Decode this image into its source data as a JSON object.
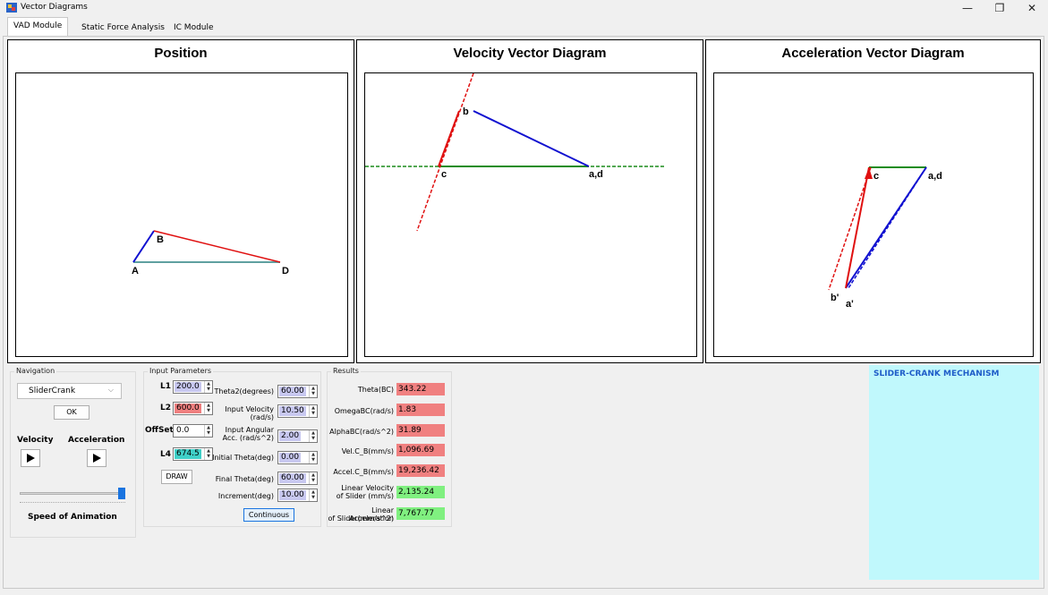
{
  "window": {
    "title": "Vector Diagrams",
    "minimize": "—",
    "restore": "❐",
    "close": "✕"
  },
  "tabs": [
    {
      "label": "VAD Module",
      "active": true
    },
    {
      "label": "Static Force Analysis",
      "active": false
    },
    {
      "label": "IC Module",
      "active": false
    }
  ],
  "panels": {
    "position": {
      "title": "Position",
      "point_labels": {
        "a": "A",
        "b": "B",
        "d": "D"
      }
    },
    "velocity": {
      "title": "Velocity Vector Diagram",
      "point_labels": {
        "b": "b",
        "c": "c",
        "ad": "a,d"
      }
    },
    "acceleration": {
      "title": "Acceleration Vector Diagram",
      "point_labels": {
        "c": "c",
        "ad": "a,d",
        "bp": "b'",
        "ap": "a'"
      }
    }
  },
  "navigation": {
    "legend": "Navigation",
    "mechanism_select": "SliderCrank",
    "ok_label": "OK",
    "velocity_label": "Velocity",
    "acceleration_label": "Acceleration",
    "speed_label": "Speed of Animation",
    "speed_value": 1.0
  },
  "inputs": {
    "legend": "Input Parameters",
    "l1": {
      "label": "L1",
      "value": "200.0"
    },
    "l2": {
      "label": "L2",
      "value": "600.0"
    },
    "offset": {
      "label": "OffSet",
      "value": "0.0"
    },
    "l4": {
      "label": "L4",
      "value": "674.5"
    },
    "theta2": {
      "label": "Theta2(degrees)",
      "value": "60.00"
    },
    "input_velocity": {
      "label_1": "Input Velocity",
      "label_2": "(rad/s)",
      "value": "10.50"
    },
    "input_angular_acc": {
      "label_1": "Input Angular",
      "label_2": "Acc. (rad/s^2)",
      "value": "2.00"
    },
    "initial_theta": {
      "label": "Initial Theta(deg)",
      "value": "0.00"
    },
    "final_theta": {
      "label": "Final Theta(deg)",
      "value": "60.00"
    },
    "increment": {
      "label": "Increment(deg)",
      "value": "10.00"
    },
    "draw_label": "DRAW",
    "continuous_label": "Continuous"
  },
  "results": {
    "legend": "Results",
    "theta_bc": {
      "label": "Theta(BC)",
      "value": "343.22"
    },
    "omega_bc": {
      "label": "OmegaBC(rad/s)",
      "value": "1.83"
    },
    "alpha_bc": {
      "label": "AlphaBC(rad/s^2)",
      "value": "31.89"
    },
    "vel_cb": {
      "label": "Vel.C_B(mm/s)",
      "value": "1,096.69"
    },
    "accel_cb": {
      "label": "Accel.C_B(mm/s)",
      "value": "19,236.42"
    },
    "lin_vel": {
      "label_1": "Linear Velocity",
      "label_2": "of Slider (mm/s)",
      "value": "2,135.24"
    },
    "lin_acc": {
      "label_1": "Linear Acceleration",
      "label_2": "of Slider(mm/s^2)",
      "value": "7,767.77"
    }
  },
  "info": {
    "title": "SLIDER-CRANK MECHANISM"
  },
  "colors": {
    "lavender": "#c8c8f0",
    "red_field": "#f08080",
    "teal_field": "#40d0c8",
    "green_field": "#80f080",
    "info_bg": "#c0f8fc",
    "info_text": "#1e5cc8"
  }
}
